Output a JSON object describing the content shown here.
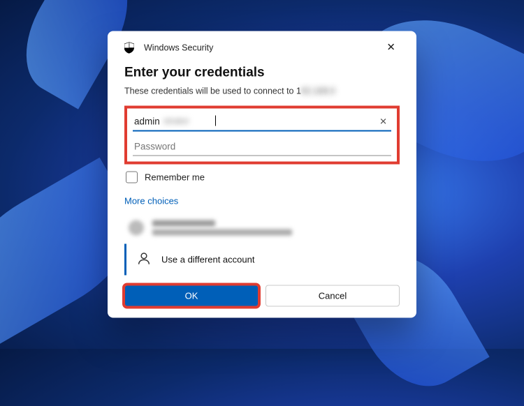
{
  "dialog": {
    "title": "Windows Security",
    "heading": "Enter your credentials",
    "subtext_prefix": "These credentials will be used to connect to 1",
    "username_value": "admin",
    "password_placeholder": "Password",
    "remember_label": "Remember me",
    "more_choices_label": "More choices",
    "different_account_label": "Use a different account",
    "ok_label": "OK",
    "cancel_label": "Cancel"
  },
  "colors": {
    "accent": "#005fb8",
    "highlight_box": "#e03c31"
  }
}
